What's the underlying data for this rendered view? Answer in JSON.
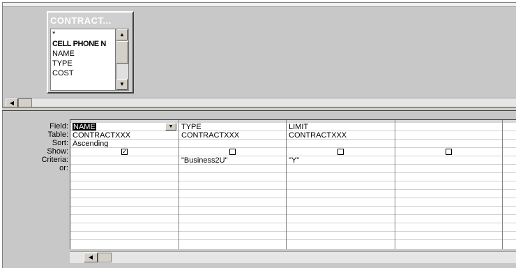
{
  "table_box": {
    "title": "CONTRACT...",
    "fields": [
      "*",
      "CELL PHONE N",
      "NAME",
      "TYPE",
      "COST"
    ]
  },
  "grid": {
    "row_labels": [
      "Field:",
      "Table:",
      "Sort:",
      "Show:",
      "Criteria:",
      "or:"
    ],
    "columns": [
      {
        "field": "NAME",
        "table": "CONTRACTXXX",
        "sort": "Ascending",
        "show": true,
        "criteria": "",
        "or": ""
      },
      {
        "field": "TYPE",
        "table": "CONTRACTXXX",
        "sort": "",
        "show": false,
        "criteria": "\"Business2U\"",
        "or": ""
      },
      {
        "field": "LIMIT",
        "table": "CONTRACTXXX",
        "sort": "",
        "show": false,
        "criteria": "\"Y\"",
        "or": ""
      },
      {
        "field": "",
        "table": "",
        "sort": "",
        "show": false,
        "criteria": "",
        "or": ""
      },
      {
        "field": "",
        "table": "",
        "sort": "",
        "show": null,
        "criteria": "",
        "or": ""
      }
    ]
  },
  "icons": {
    "scroll_up": "▲",
    "scroll_down": "▼",
    "scroll_left": "◀",
    "dropdown": "▼",
    "check": "✓"
  },
  "colors": {
    "pane_bg": "#c8c8c8",
    "selection_bg": "#000000",
    "selection_fg": "#ffffff"
  }
}
